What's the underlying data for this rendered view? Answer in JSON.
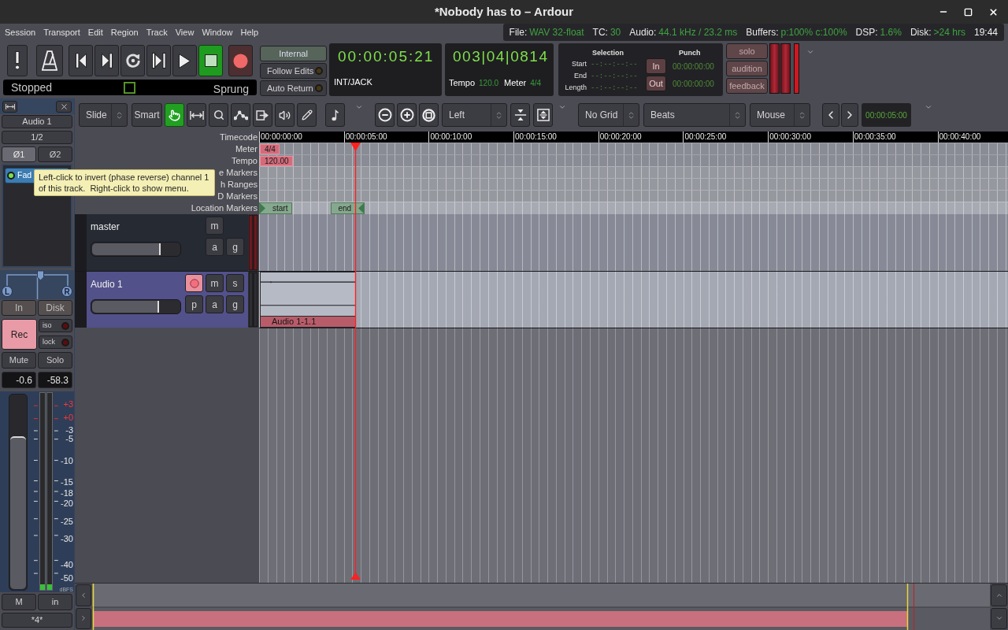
{
  "window": {
    "title": "*Nobody has to – Ardour"
  },
  "menu_bar": {
    "items": [
      "Session",
      "Transport",
      "Edit",
      "Region",
      "Track",
      "View",
      "Window",
      "Help"
    ]
  },
  "status_bar": {
    "items": [
      {
        "label": "File:",
        "value": "WAV 32-float"
      },
      {
        "label": "TC:",
        "value": "30"
      },
      {
        "label": "Audio:",
        "value": "44.1 kHz / 23.2 ms"
      },
      {
        "label": "Buffers:",
        "value": "p:100% c:100%"
      },
      {
        "label": "DSP:",
        "value": "1.6%"
      },
      {
        "label": "Disk:",
        "value": ">24 hrs"
      }
    ],
    "time": "19:44"
  },
  "transport": {
    "buttons": [
      {
        "kind": "error_log",
        "active": false
      },
      {
        "kind": "metronome",
        "active": false
      },
      {
        "kind": "goto_start",
        "active": false
      },
      {
        "kind": "goto_end",
        "active": false
      },
      {
        "kind": "loop",
        "active": false
      },
      {
        "kind": "play_range",
        "active": false
      },
      {
        "kind": "play",
        "active": false
      },
      {
        "kind": "stop",
        "active": true
      },
      {
        "kind": "record",
        "active": false
      }
    ],
    "state": "Stopped",
    "mode": "Sprung"
  },
  "sync": {
    "source": "Internal",
    "options": [
      {
        "label": "Follow Edits",
        "on": false
      },
      {
        "label": "Auto Return",
        "on": false
      }
    ]
  },
  "primary_clock": {
    "time": "00:00:05:21",
    "source": "INT/JACK"
  },
  "secondary_clock": {
    "time": "003|04|0814",
    "tempo_label": "Tempo",
    "tempo": "120.0",
    "meter_label": "Meter",
    "meter": "4/4"
  },
  "selection": {
    "title": "Selection",
    "rows": [
      {
        "label": "Start",
        "value": "--:--:--:--"
      },
      {
        "label": "End",
        "value": "--:--:--:--"
      },
      {
        "label": "Length",
        "value": "--:--:--:--"
      }
    ]
  },
  "punch": {
    "title": "Punch",
    "rows": [
      {
        "button": "In",
        "on": false,
        "time": "00:00:00:00"
      },
      {
        "button": "Out",
        "on": false,
        "time": "00:00:00:00"
      }
    ]
  },
  "monitor_section": {
    "buttons": [
      {
        "label": "solo",
        "on": false
      },
      {
        "label": "audition",
        "on": false
      },
      {
        "label": "feedback",
        "on": false
      }
    ]
  },
  "editor_toolbar": {
    "edit_mode": "Slide",
    "tool_mode": "Smart",
    "tools": [
      {
        "kind": "grab",
        "selected": true
      },
      {
        "kind": "range",
        "selected": false
      },
      {
        "kind": "zoom",
        "selected": false
      },
      {
        "kind": "gain",
        "selected": false
      },
      {
        "kind": "stretch",
        "selected": false
      },
      {
        "kind": "audition",
        "selected": false
      },
      {
        "kind": "draw",
        "selected": false
      }
    ],
    "internal_edit": {
      "selected": false
    },
    "zoom_focus": "Left",
    "grid": "No Grid",
    "grid_type": "Beats",
    "edit_point": "Mouse",
    "nudge_clock": "00:00:05:00"
  },
  "rulers": [
    {
      "kind": "timecode",
      "label": "Timecode",
      "ticks": [
        "00:00:00:00",
        "00:00:05:00",
        "00:00:10:00",
        "00:00:15:00",
        "00:00:20:00",
        "00:00:25:00",
        "00:00:30:00",
        "00:00:35:00",
        "00:00:40:00"
      ]
    },
    {
      "kind": "meter",
      "label": "Meter",
      "markers": [
        {
          "label": "4/4"
        }
      ]
    },
    {
      "kind": "tempo",
      "label": "Tempo",
      "markers": [
        {
          "label": "120.00"
        }
      ]
    },
    {
      "kind": "range",
      "label": "e Markers"
    },
    {
      "kind": "loop_punch",
      "label": "h Ranges"
    },
    {
      "kind": "cd",
      "label": "D Markers"
    },
    {
      "kind": "location",
      "label": "Location Markers",
      "markers": [
        {
          "label": "start"
        },
        {
          "label": "end"
        }
      ]
    }
  ],
  "tracks": [
    {
      "name": "master",
      "kind": "bus",
      "selected": false,
      "top_buttons": [
        "m"
      ],
      "bottom_buttons": [
        "a",
        "g"
      ],
      "fader": {
        "level": 0.78
      }
    },
    {
      "name": "Audio 1",
      "kind": "audio",
      "selected": true,
      "rec_armed": true,
      "top_buttons": [
        "m",
        "s"
      ],
      "bottom_buttons": [
        "p",
        "a",
        "g"
      ],
      "fader": {
        "level": 0.77
      },
      "regions": [
        {
          "name": "Audio 1-1.1"
        }
      ]
    }
  ],
  "mixer_strip": {
    "name": "Audio 1",
    "input": "1/2",
    "phase_invert": [
      {
        "label": "Ø1",
        "highlighted": true
      },
      {
        "label": "Ø2",
        "highlighted": false
      }
    ],
    "processors": [
      {
        "name": "Fad",
        "active": true
      }
    ],
    "panner": {
      "left": "L",
      "right": "R",
      "level": 0.5
    },
    "monitoring": [
      {
        "label": "In",
        "on": false
      },
      {
        "label": "Disk",
        "on": false
      }
    ],
    "rec": {
      "label": "Rec",
      "armed": true
    },
    "safe_buttons": [
      {
        "label": "iso",
        "on": false
      },
      {
        "label": "lock",
        "on": false
      }
    ],
    "mute": {
      "label": "Mute",
      "on": false
    },
    "solo": {
      "label": "Solo",
      "on": false
    },
    "gain": "-0.6",
    "peak": "-58.3",
    "fader": {
      "level": 0.79
    },
    "meters": [
      {
        "level": 0.03
      },
      {
        "level": 0.03
      }
    ],
    "meter_scale": [
      {
        "label": "+3",
        "kind": "over"
      },
      {
        "label": "+0",
        "kind": "over"
      },
      {
        "label": "-3",
        "kind": "normal"
      },
      {
        "label": "-5",
        "kind": "normal"
      },
      {
        "label": "-10",
        "kind": "normal"
      },
      {
        "label": "-15",
        "kind": "normal"
      },
      {
        "label": "-18",
        "kind": "normal"
      },
      {
        "label": "-20",
        "kind": "normal"
      },
      {
        "label": "-25",
        "kind": "normal"
      },
      {
        "label": "-30",
        "kind": "normal"
      },
      {
        "label": "-40",
        "kind": "normal"
      },
      {
        "label": "-50",
        "kind": "normal"
      },
      {
        "label": "dBFS",
        "kind": "unit"
      }
    ],
    "bottom_buttons": [
      "M",
      "in"
    ],
    "comments": "*4*"
  },
  "tooltip": {
    "text": "Left-click to invert (phase reverse) channel 1 of this track.  Right-click to show menu."
  }
}
